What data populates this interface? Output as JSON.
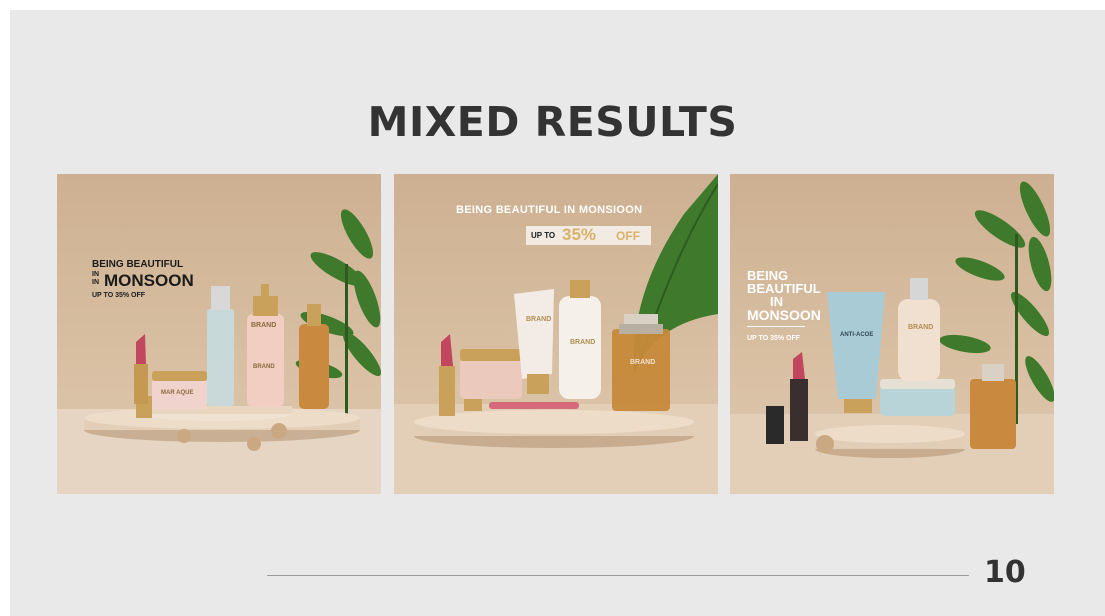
{
  "slide": {
    "title": "MIXED RESULTS",
    "page_number": "10"
  },
  "panels": [
    {
      "headline_line1": "BEING BEAUTIFUL",
      "headline_small": "IN",
      "headline_small2": "IN",
      "headline_big": "MONSOON",
      "offer": "UP TO 35% OFF",
      "product_labels": [
        "BRAND",
        "MAR AQUE",
        "BRAND"
      ]
    },
    {
      "headline": "BEING BEAUTIFUL IN MONSIOON",
      "offer_prefix": "UP TO",
      "offer_value": "35%",
      "offer_suffix": "OFF",
      "product_labels": [
        "BRAND",
        "BRAND",
        "BRAND"
      ]
    },
    {
      "headline_line1": "BEING",
      "headline_line2": "BEAUTIFUL",
      "headline_line3": "IN",
      "headline_line4": "MONSOON",
      "offer": "UP TO 35% OFF",
      "product_labels": [
        "ANTI-ACOE",
        "BRAND"
      ]
    }
  ],
  "colors": {
    "slide_bg": "#e9e9e9",
    "title": "#333333",
    "panel_bg": "#d4b89a",
    "leaf": "#3f7a2c",
    "lipstick": "#c2465e",
    "gold": "#c9a15a"
  }
}
